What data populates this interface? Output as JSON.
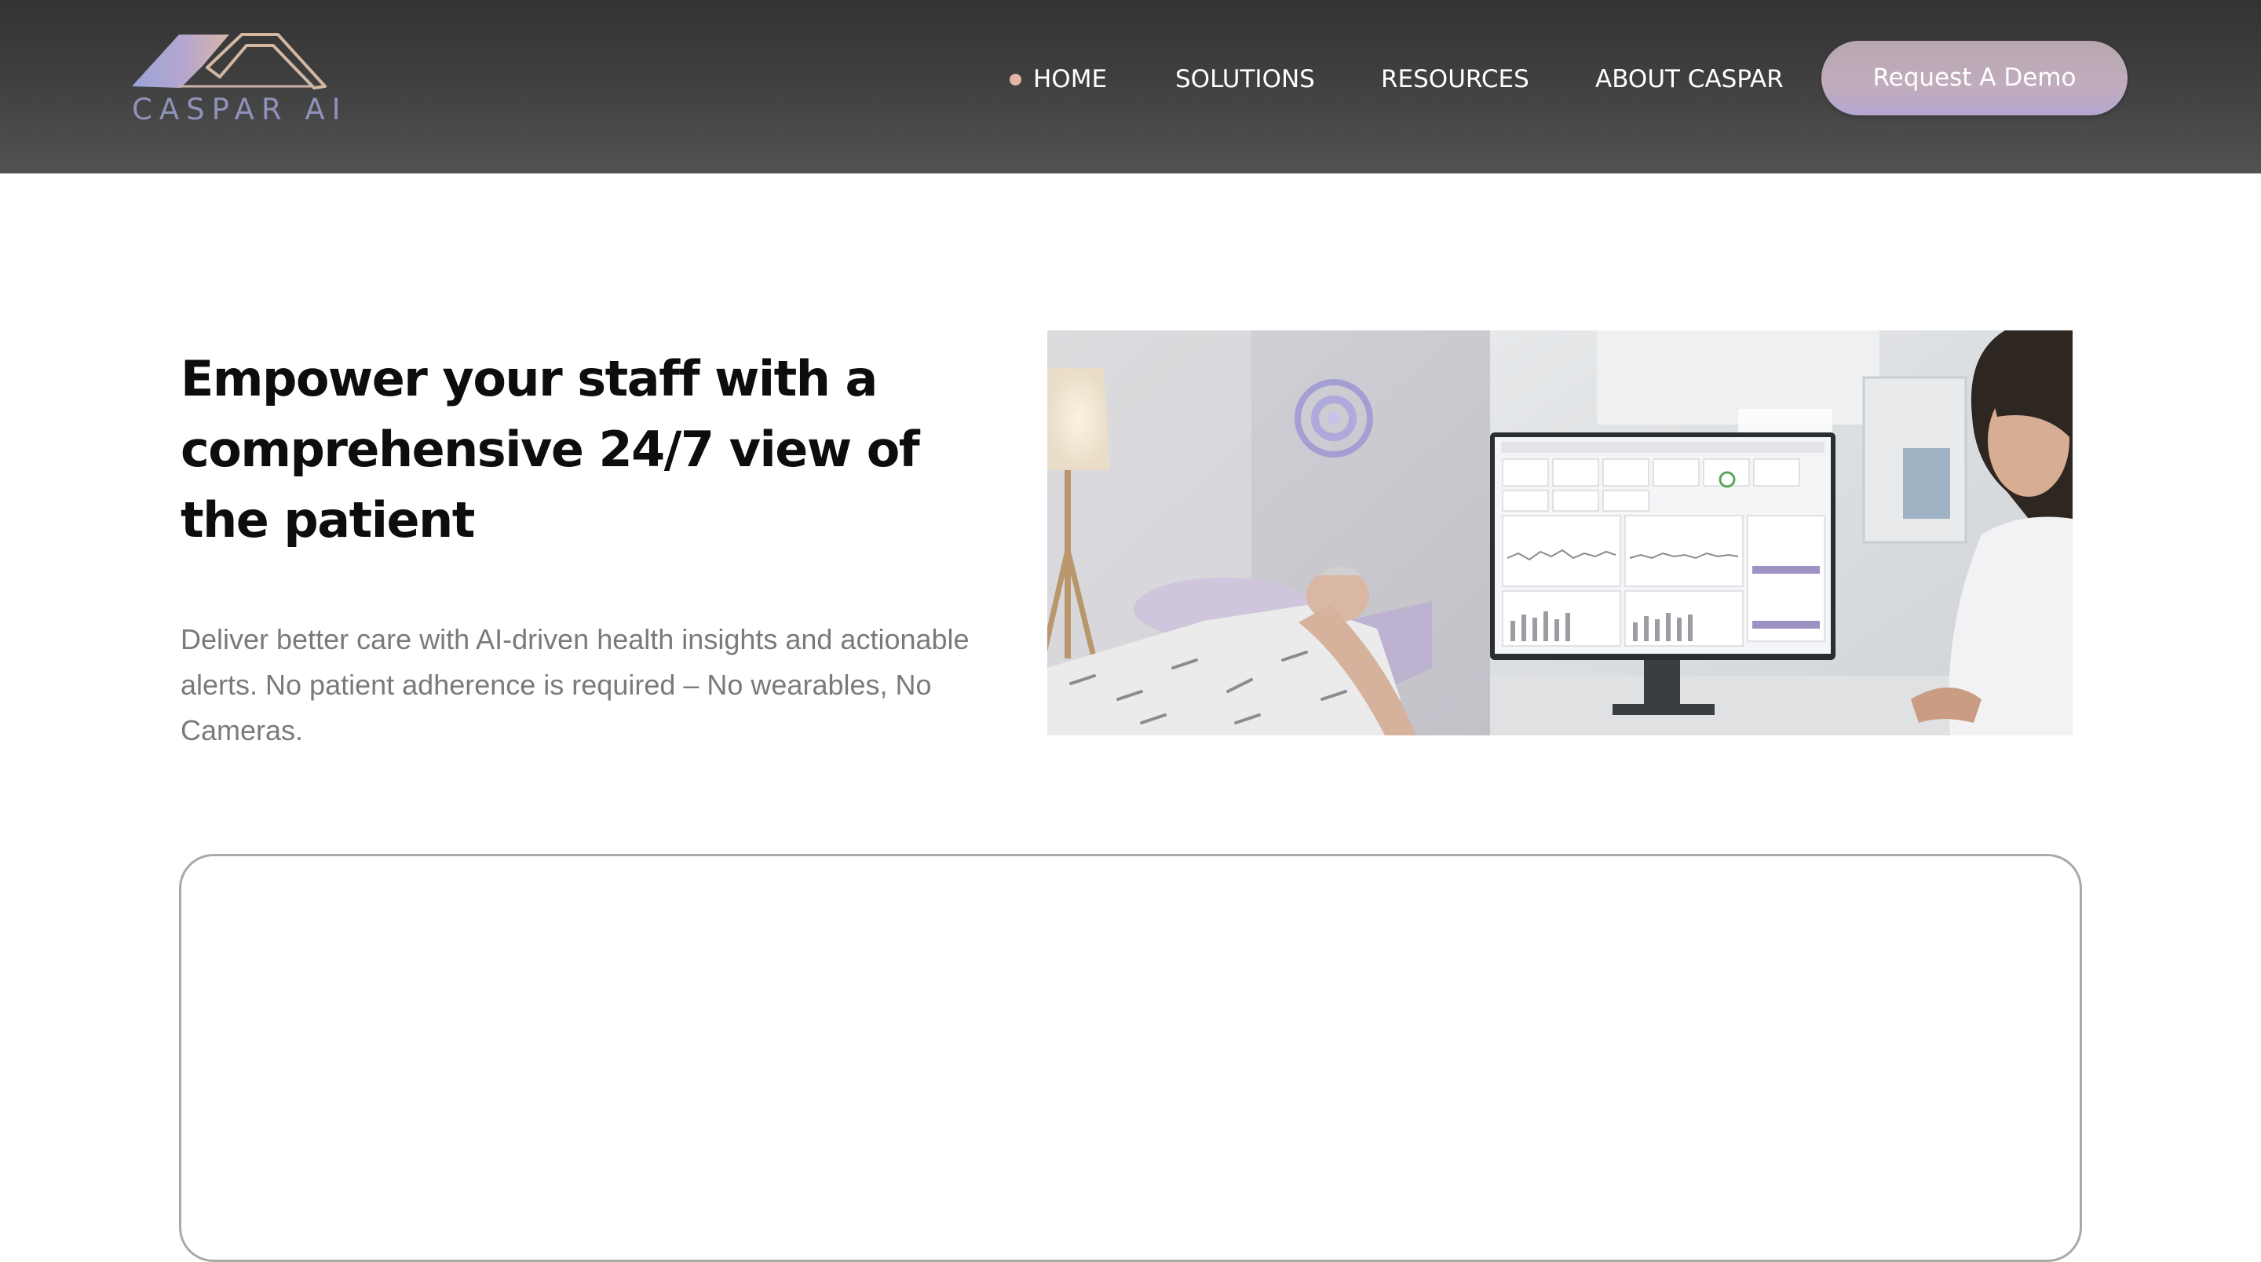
{
  "header": {
    "logo_text": "CASPAR AI",
    "nav": {
      "home": "HOME",
      "solutions": "SOLUTIONS",
      "resources": "RESOURCES",
      "about": "ABOUT CASPAR"
    },
    "demo_button": "Request A Demo"
  },
  "hero": {
    "title": "Empower your staff with a comprehensive 24/7 view of the patient",
    "description": "Deliver better care with AI-driven health insights and actionable alerts. No patient adherence is required – No wearables, No Cameras."
  },
  "colors": {
    "accent": "#c1acbc",
    "logo": "#8f92b8",
    "active_dot": "#e2b7a6",
    "body_text": "#7a7a7a"
  }
}
